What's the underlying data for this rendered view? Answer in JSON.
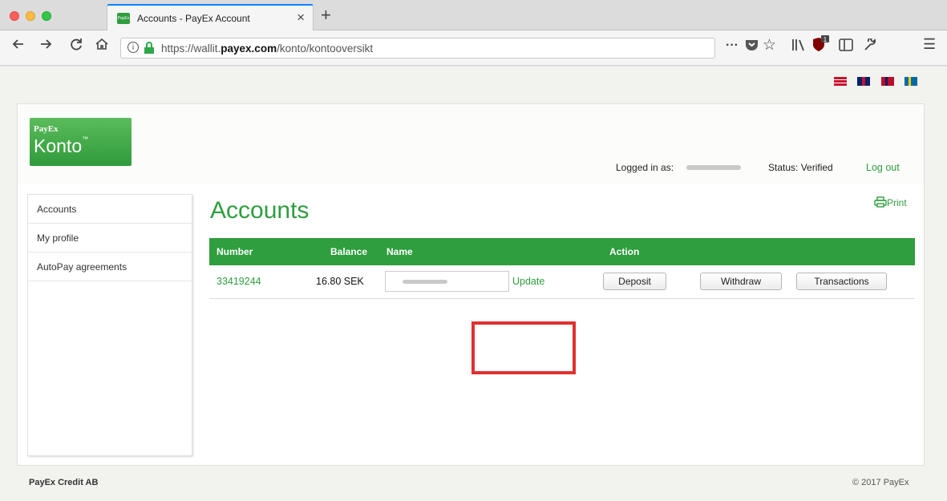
{
  "browser": {
    "tab_title": "Accounts - PayEx Account",
    "tab_favicon_text": "PayEx",
    "close_glyph": "×",
    "newtab_glyph": "+",
    "url_prefix": "https://wallit.",
    "url_domain": "payex.com",
    "url_path": "/konto/kontooversikt",
    "nav_icons": [
      "back-icon",
      "forward-icon",
      "reload-icon",
      "home-icon"
    ],
    "right_icons": [
      "page-actions-icon",
      "pocket-icon",
      "bookmark-star-icon",
      "library-icon",
      "ublock-icon",
      "sidebar-icon",
      "tools-icon",
      "menu-icon"
    ],
    "badge_count": "1"
  },
  "language_flags": [
    "danish-flag-icon",
    "english-flag-icon",
    "norwegian-flag-icon",
    "swedish-flag-icon"
  ],
  "header": {
    "logo_small": "PayEx",
    "logo_big": "Konto",
    "logo_tm": "™",
    "logged_in_label": "Logged in as:",
    "status": "Status: Verified",
    "logout": "Log out"
  },
  "sidebar": {
    "items": [
      {
        "label": "Accounts"
      },
      {
        "label": "My profile"
      },
      {
        "label": "AutoPay agreements"
      }
    ]
  },
  "main": {
    "title": "Accounts",
    "print": "Print",
    "table": {
      "headers": [
        "Number",
        "Balance",
        "Name",
        "Action"
      ],
      "rows": [
        {
          "number": "33419244",
          "balance": "16.80 SEK",
          "update": "Update",
          "deposit": "Deposit",
          "withdraw": "Withdraw",
          "transactions": "Transactions"
        }
      ]
    }
  },
  "footer": {
    "left": "PayEx Credit AB",
    "right": "© 2017 PayEx"
  },
  "colors": {
    "brand_green": "#2e9e3e",
    "highlight_red": "#e03030"
  }
}
